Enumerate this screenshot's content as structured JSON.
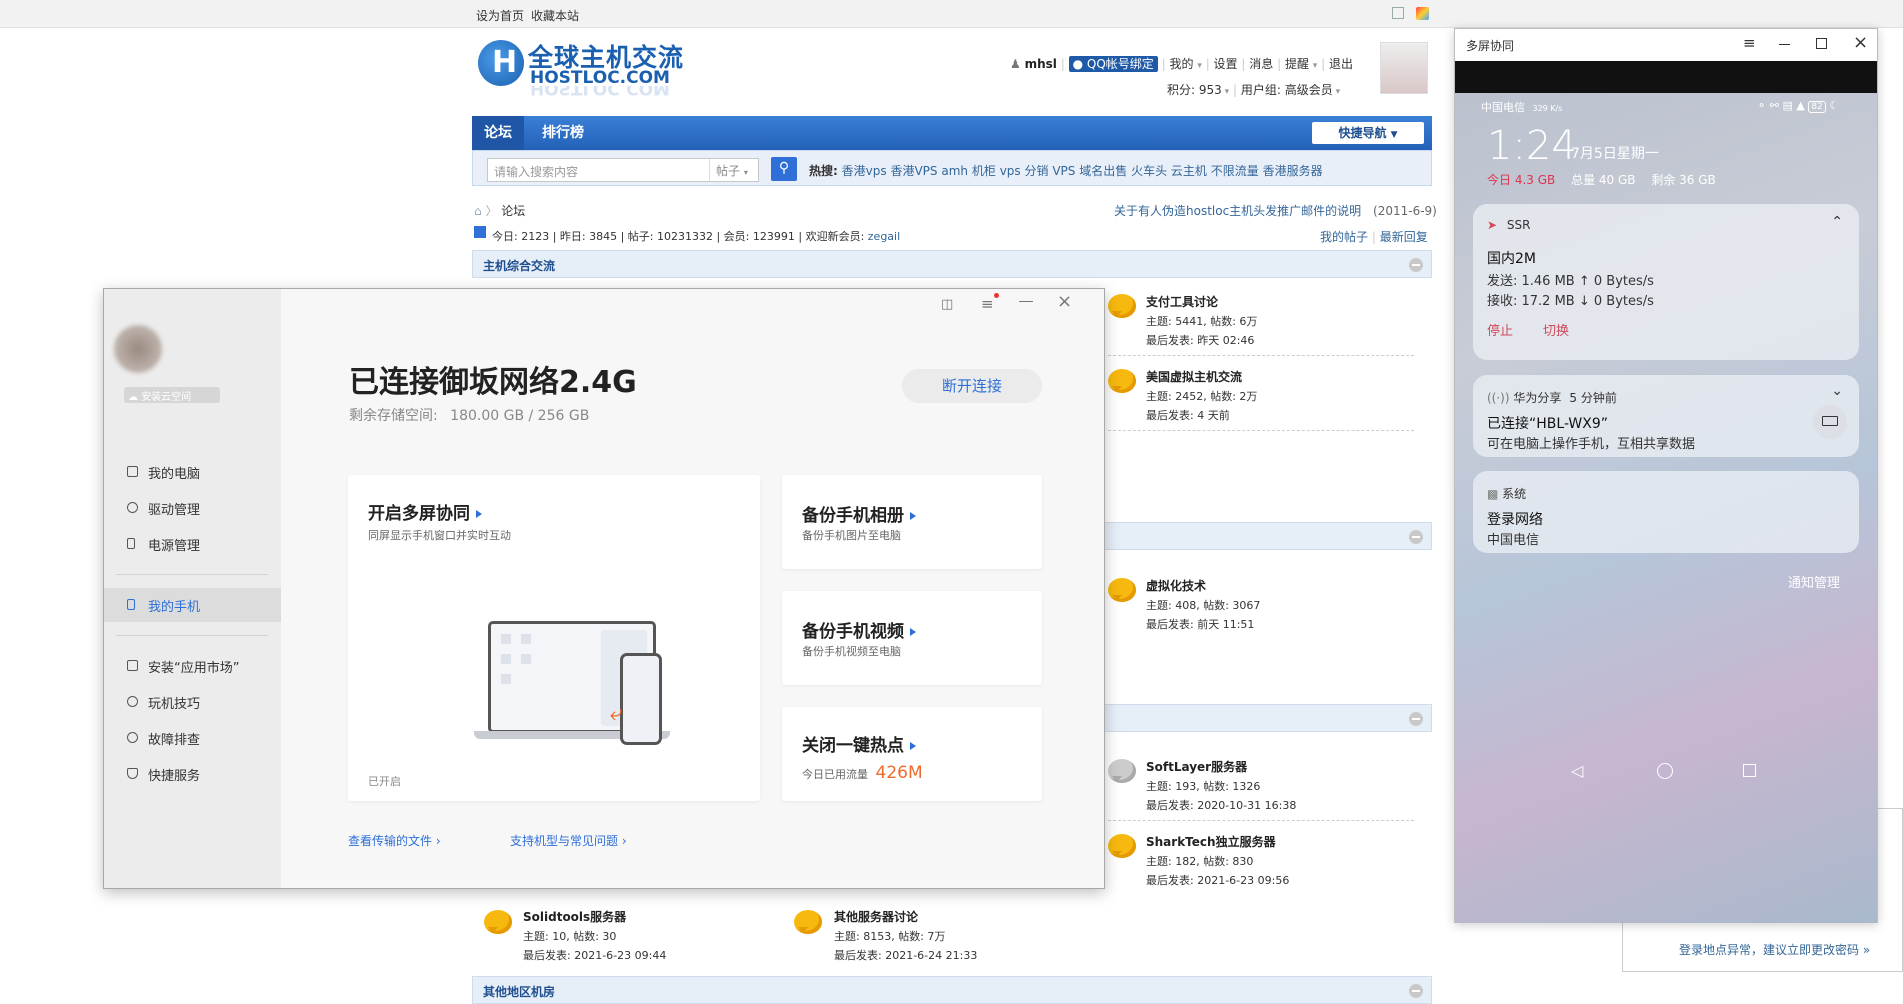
{
  "topbar": {
    "set_home": "设为首页",
    "bookmark": "收藏本站"
  },
  "forum": {
    "logo_cn": "全球主机交流",
    "logo_en": "HOSTLOC.COM",
    "user": {
      "name": "mhsl",
      "qq_bind": "QQ帐号绑定",
      "mine": "我的",
      "settings": "设置",
      "messages": "消息",
      "remind": "提醒",
      "logout": "退出",
      "points": "积分: 953",
      "group": "用户组: 高级会员"
    },
    "nav": {
      "forum": "论坛",
      "rank": "排行榜",
      "quick_nav": "快捷导航"
    },
    "search": {
      "placeholder": "请输入搜索内容",
      "type": "帖子",
      "hot_label": "热搜:",
      "hot": [
        "香港vps",
        "香港VPS",
        "amh",
        "机柜",
        "vps",
        "分销",
        "VPS",
        "域名出售",
        "火车头",
        "云主机",
        "不限流量",
        "香港服务器"
      ]
    },
    "breadcrumb": "论坛",
    "notice": "关于有人伪造hostloc主机头发推广邮件的说明",
    "notice_date": "(2011-6-9)",
    "stats": "今日: 2123 | 昨日: 3845 | 帖子: 10231332 | 会员: 123991 | 欢迎新会员:",
    "newest_member": "zegail",
    "my_posts": "我的帖子",
    "latest_reply": "最新回复",
    "sections": {
      "s1": "主机综合交流",
      "last": "其他地区机房"
    },
    "forums": [
      {
        "name": "支付工具讨论",
        "stats": "主题: 5441, 帖数: 6万",
        "last": "最后发表: 昨天 02:46"
      },
      {
        "name": "美国虚拟主机交流",
        "stats": "主题: 2452, 帖数: 2万",
        "last": "最后发表: 4 天前"
      },
      {
        "name": "虚拟化技术",
        "stats": "主题: 408, 帖数: 3067",
        "last": "最后发表: 前天 11:51"
      },
      {
        "name": "SoftLayer服务器",
        "stats": "主题: 193, 帖数: 1326",
        "last": "最后发表: 2020-10-31 16:38"
      },
      {
        "name": "SharkTech独立服务器",
        "stats": "主题: 182, 帖数: 830",
        "last": "最后发表: 2021-6-23 09:56"
      },
      {
        "name": "Solidtools服务器",
        "stats": "主题: 10, 帖数: 30",
        "last": "最后发表: 2021-6-23 09:44"
      },
      {
        "name": "其他服务器讨论",
        "stats": "主题: 8153, 帖数: 7万",
        "last": "最后发表: 2021-6-24 21:33"
      }
    ],
    "login_warning": "登录地点异常，建议立即更改密码 »"
  },
  "hisuite": {
    "cloud": "安装云空间",
    "menu": [
      "我的电脑",
      "驱动管理",
      "电源管理",
      "我的手机",
      "安装“应用市场”",
      "玩机技巧",
      "故障排查",
      "快捷服务"
    ],
    "title": "已连接御坂网络2.4G",
    "storage_label": "剩余存储空间:",
    "storage_value": "180.00 GB / 256 GB",
    "disconnect": "断开连接",
    "multiscreen_title": "开启多屏协同",
    "multiscreen_sub": "同屏显示手机窗口并实时互动",
    "multiscreen_state": "已开启",
    "backup_photo_title": "备份手机相册",
    "backup_photo_sub": "备份手机图片至电脑",
    "backup_video_title": "备份手机视频",
    "backup_video_sub": "备份手机视频至电脑",
    "hotspot_title": "关闭一键热点",
    "hotspot_sub": "今日已用流量",
    "hotspot_value": "426M",
    "view_files": "查看传输的文件 ›",
    "support": "支持机型与常见问题 ›"
  },
  "phone": {
    "window_title": "多屏协同",
    "carrier": "中国电信",
    "speed": "329 K/s",
    "battery": "82",
    "time": "1:24",
    "date": "7月5日星期一",
    "today": "今日 4.3 GB",
    "total": "总量 40 GB",
    "remain": "剩余 36 GB",
    "ssr": {
      "app": "SSR",
      "server": "国内2M",
      "send": "发送:  1.46 MB ↑  0 Bytes/s",
      "recv": "接收:  17.2 MB ↓  0 Bytes/s",
      "stop": "停止",
      "switch": "切换"
    },
    "share": {
      "app": "华为分享",
      "time": "5 分钟前",
      "title": "已连接“HBL-WX9”",
      "body": "可在电脑上操作手机，互相共享数据"
    },
    "system": {
      "app": "系统",
      "title": "登录网络",
      "body": "中国电信"
    },
    "manage": "通知管理"
  },
  "colors": {
    "accent": "#2e6fd8",
    "forum_nav": "#2b6bc5",
    "ssr_red": "#d04a5a",
    "hotspot_orange": "#f06a2c"
  }
}
